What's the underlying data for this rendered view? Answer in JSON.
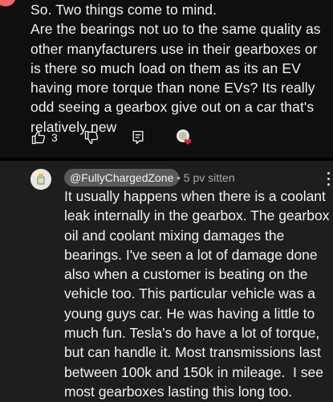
{
  "comment": {
    "body": "So. Two things come to mind.\nAre the bearings not uo to the same quality as other manyfacturers use in their gearboxes or is there so much load on them as its an EV having more torque than none EVs? Its really odd seeing a gearbox give out on a car that's relatively new",
    "like_count": "3"
  },
  "reply": {
    "author": "@FullyChargedZone",
    "meta": "• 5 pv sitten",
    "body": "It usually happens when there is a coolant leak internally in the gearbox. The gearbox oil and coolant mixing damages the bearings. I've seen a lot of damage done also when a customer is beating on the vehicle too. This particular vehicle was a young guys car. He was having a little to much fun. Tesla's do have a lot of torque, but can handle it. Most transmissions last between 100k and 150k in mileage.  I see most gearboxes lasting this long too."
  },
  "icons": {
    "like": "thumbs-up-icon",
    "dislike": "thumbs-down-icon",
    "reply": "reply-icon",
    "creator_heart": "creator-heart-icon",
    "more": "more-vert-icon"
  },
  "colors": {
    "background": "#0f0f0f",
    "reply_background": "#1e1e1e",
    "author_chip": "#5a5a5a",
    "heart": "#e0243a"
  }
}
